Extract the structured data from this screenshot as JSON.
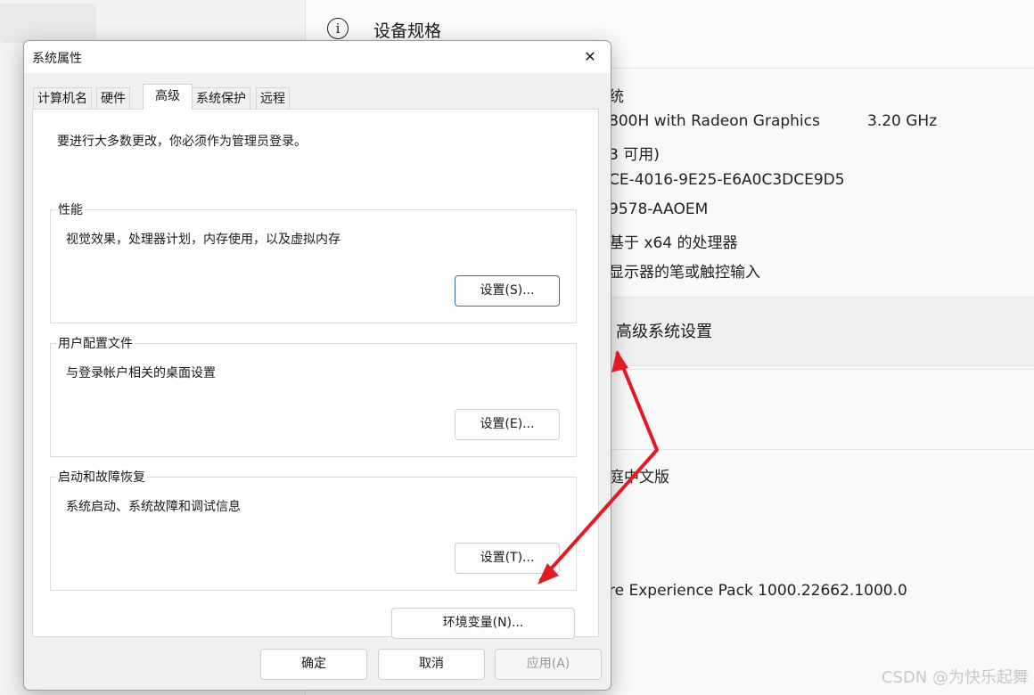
{
  "background_window": {
    "header_title": "设备规格",
    "spec_lines": [
      "统",
      "800H with Radeon Graphics",
      "3 可用)",
      "CE-4016-9E25-E6A0C3DCE9D5",
      "9578-AAOEM",
      "基于 x64 的处理器",
      "显示器的笔或触控输入"
    ],
    "spec_frequency": "3.20 GHz",
    "advanced_settings_link": "高级系统设置",
    "edition_fragment": "庭中文版",
    "experience_fragment": "re Experience Pack 1000.22662.1000.0"
  },
  "dialog": {
    "title": "系统属性",
    "close_glyph": "✕",
    "tabs": [
      {
        "label": "计算机名"
      },
      {
        "label": "硬件"
      },
      {
        "label": "高级"
      },
      {
        "label": "系统保护"
      },
      {
        "label": "远程"
      }
    ],
    "active_tab": "高级",
    "admin_note": "要进行大多数更改，你必须作为管理员登录。",
    "groups": [
      {
        "title": "性能",
        "description": "视觉效果，处理器计划，内存使用，以及虚拟内存",
        "button": "设置(S)..."
      },
      {
        "title": "用户配置文件",
        "description": "与登录帐户相关的桌面设置",
        "button": "设置(E)..."
      },
      {
        "title": "启动和故障恢复",
        "description": "系统启动、系统故障和调试信息",
        "button": "设置(T)..."
      }
    ],
    "env_button": "环境变量(N)...",
    "footer": {
      "ok": "确定",
      "cancel": "取消",
      "apply": "应用(A)"
    }
  },
  "watermark": "CSDN @为快乐起舞",
  "colors": {
    "arrow": "#e01b24",
    "focus_border": "#3a6ea5"
  }
}
